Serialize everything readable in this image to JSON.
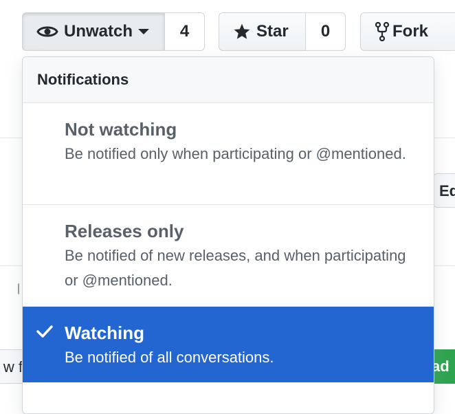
{
  "repo_actions": {
    "watch": {
      "label": "Unwatch",
      "count": "4"
    },
    "star": {
      "label": "Star",
      "count": "0"
    },
    "fork": {
      "label": "Fork"
    }
  },
  "background": {
    "edit_label": "Ed",
    "left_button_text": "w f",
    "green_button_text": "ad"
  },
  "notifications_menu": {
    "header": "Notifications",
    "options": [
      {
        "title": "Not watching",
        "description": "Be notified only when participating or @mentioned.",
        "selected": false
      },
      {
        "title": "Releases only",
        "description": "Be notified of new releases, and when participating or @mentioned.",
        "selected": false
      },
      {
        "title": "Watching",
        "description": "Be notified of all conversations.",
        "selected": true
      }
    ]
  },
  "colors": {
    "selected_background": "#2366d1",
    "header_background": "#f6f8fa",
    "muted_text": "#586069"
  }
}
